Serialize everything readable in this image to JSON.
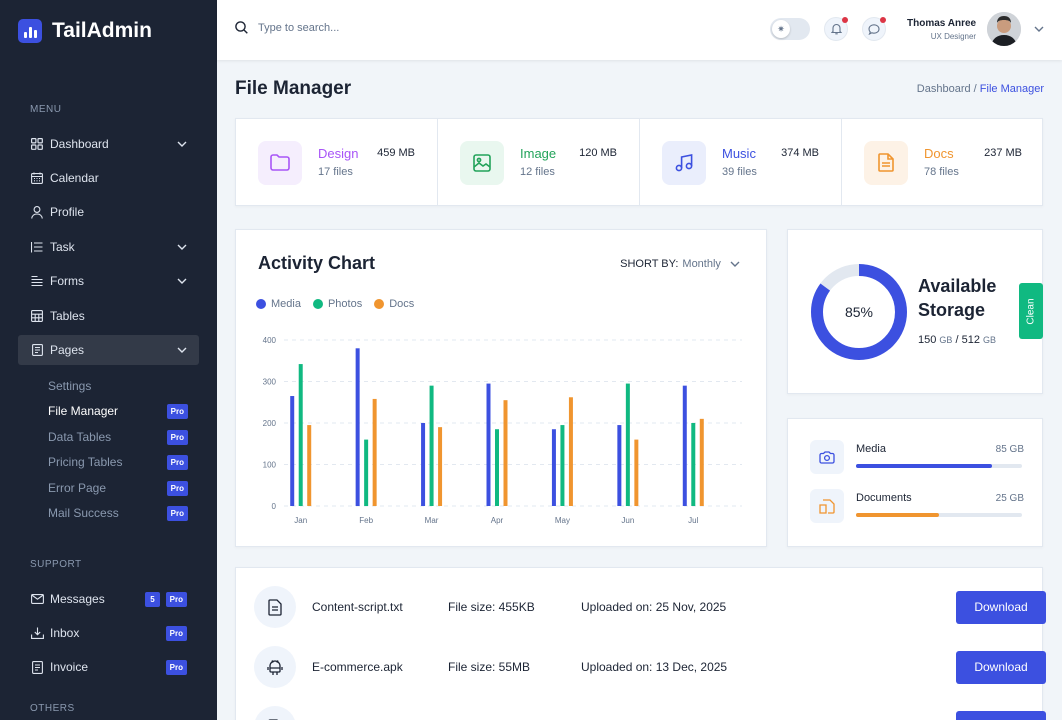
{
  "app": {
    "name": "TailAdmin"
  },
  "sidebar": {
    "groups": [
      "MENU",
      "SUPPORT",
      "OTHERS"
    ],
    "menu": [
      {
        "label": "Dashboard",
        "icon": "grid-icon"
      },
      {
        "label": "Calendar",
        "icon": "calendar-icon"
      },
      {
        "label": "Profile",
        "icon": "user-icon"
      },
      {
        "label": "Task",
        "icon": "list-icon"
      },
      {
        "label": "Forms",
        "icon": "forms-icon"
      },
      {
        "label": "Tables",
        "icon": "table-icon"
      },
      {
        "label": "Pages",
        "icon": "pages-icon"
      }
    ],
    "pages_sub": [
      {
        "label": "Settings"
      },
      {
        "label": "File Manager",
        "pro": "Pro"
      },
      {
        "label": "Data Tables",
        "pro": "Pro"
      },
      {
        "label": "Pricing Tables",
        "pro": "Pro"
      },
      {
        "label": "Error Page",
        "pro": "Pro"
      },
      {
        "label": "Mail Success",
        "pro": "Pro"
      }
    ],
    "support": [
      {
        "label": "Messages",
        "count": "5",
        "pro": "Pro"
      },
      {
        "label": "Inbox",
        "pro": "Pro"
      },
      {
        "label": "Invoice",
        "pro": "Pro"
      }
    ]
  },
  "header": {
    "search_placeholder": "Type to search...",
    "user_name": "Thomas Anree",
    "user_role": "UX Designer"
  },
  "page": {
    "title": "File Manager",
    "breadcrumb_root": "Dashboard /",
    "breadcrumb_current": "File Manager"
  },
  "stats": [
    {
      "name": "Design",
      "files": "17 files",
      "size": "459 MB",
      "color": "#a855f7"
    },
    {
      "name": "Image",
      "files": "12 files",
      "size": "120 MB",
      "color": "#22a35a"
    },
    {
      "name": "Music",
      "files": "39 files",
      "size": "374 MB",
      "color": "#3c50e0"
    },
    {
      "name": "Docs",
      "files": "78 files",
      "size": "237 MB",
      "color": "#f0952f"
    }
  ],
  "activity": {
    "title": "Activity Chart",
    "sort_label": "SHORT BY:",
    "sort_value": "Monthly"
  },
  "chart_data": {
    "type": "bar",
    "categories": [
      "Jan",
      "Feb",
      "Mar",
      "Apr",
      "May",
      "Jun",
      "Jul"
    ],
    "series": [
      {
        "name": "Media",
        "color": "#3c50e0",
        "values": [
          265,
          380,
          200,
          295,
          185,
          195,
          290
        ]
      },
      {
        "name": "Photos",
        "color": "#10b981",
        "values": [
          342,
          160,
          290,
          185,
          195,
          295,
          200
        ]
      },
      {
        "name": "Docs",
        "color": "#f0952f",
        "values": [
          195,
          258,
          190,
          255,
          262,
          160,
          210
        ]
      }
    ],
    "yticks": [
      "0",
      "100",
      "200",
      "300",
      "400"
    ],
    "ylim": [
      0,
      400
    ],
    "legend": "top-left",
    "grid": true
  },
  "storage": {
    "percent_label": "85%",
    "percent": 85,
    "title": "Available Storage",
    "used": "150",
    "used_unit": "GB",
    "sep": " / ",
    "total": "512",
    "total_unit": "GB",
    "clean_label": "Clean"
  },
  "usage": [
    {
      "name": "Media",
      "size": "85 GB",
      "fraction": 0.82,
      "color": "#3c50e0"
    },
    {
      "name": "Documents",
      "size": "25 GB",
      "fraction": 0.5,
      "color": "#f0952f"
    }
  ],
  "files": [
    {
      "name": "Content-script.txt",
      "size": "File size: 455KB",
      "date": "Uploaded on: 25 Nov, 2025",
      "action": "Download"
    },
    {
      "name": "E-commerce.apk",
      "size": "File size: 55MB",
      "date": "Uploaded on: 13 Dec, 2025",
      "action": "Download"
    }
  ]
}
